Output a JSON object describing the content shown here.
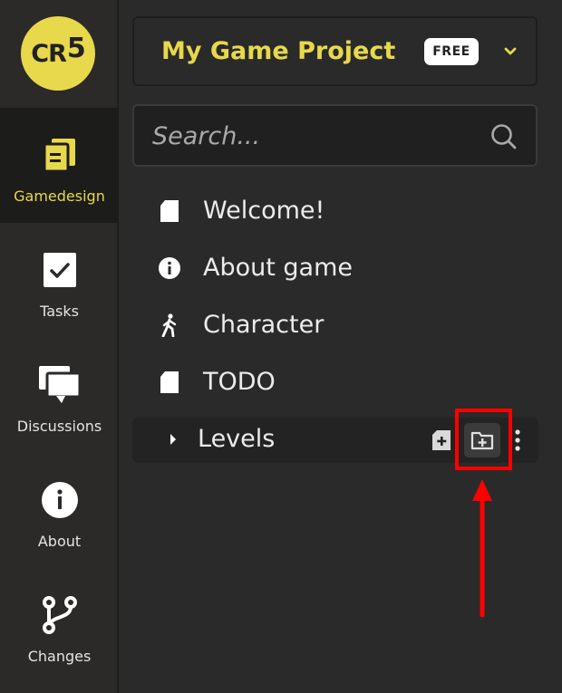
{
  "logo": {
    "text": "CR",
    "superscript": "5",
    "color": "#e8d84b"
  },
  "nav": {
    "items": [
      {
        "label": "Gamedesign",
        "icon": "documents-icon",
        "active": true
      },
      {
        "label": "Tasks",
        "icon": "checkbox-icon",
        "active": false
      },
      {
        "label": "Discussions",
        "icon": "chat-bubbles-icon",
        "active": false
      },
      {
        "label": "About",
        "icon": "info-icon",
        "active": false
      },
      {
        "label": "Changes",
        "icon": "branch-icon",
        "active": false
      }
    ]
  },
  "project": {
    "title": "My Game Project",
    "badge": "FREE",
    "dropdown_icon": "chevron-down-icon"
  },
  "search": {
    "placeholder": "Search...",
    "value": "",
    "icon": "search-icon"
  },
  "tree": {
    "items": [
      {
        "label": "Welcome!",
        "icon": "document-icon"
      },
      {
        "label": "About game",
        "icon": "info-icon"
      },
      {
        "label": "Character",
        "icon": "walking-person-icon"
      },
      {
        "label": "TODO",
        "icon": "document-icon"
      }
    ],
    "folder": {
      "label": "Levels",
      "caret_icon": "caret-right-icon",
      "actions": [
        "new-document-icon",
        "new-folder-icon",
        "more-vertical-icon"
      ]
    }
  },
  "colors": {
    "accent": "#e8d84b",
    "background": "#2a2a2a",
    "highlight": "#ff0000"
  }
}
